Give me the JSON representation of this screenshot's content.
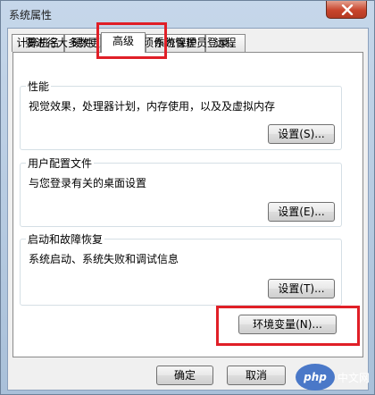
{
  "window": {
    "title": "系统属性"
  },
  "tabs": [
    {
      "label": "计算机名",
      "active": false
    },
    {
      "label": "硬件",
      "active": false
    },
    {
      "label": "高级",
      "active": true
    },
    {
      "label": "系统保护",
      "active": false
    },
    {
      "label": "远程",
      "active": false
    }
  ],
  "panel": {
    "admin_note": "要进行大多数更改，您必须作为管理员登录。",
    "performance": {
      "title": "性能",
      "description": "视觉效果，处理器计划，内存使用，以及及虚拟内存",
      "button": "设置(S)..."
    },
    "user_profiles": {
      "title": "用户配置文件",
      "description": "与您登录有关的桌面设置",
      "button": "设置(E)..."
    },
    "startup_recovery": {
      "title": "启动和故障恢复",
      "description": "系统启动、系统失败和调试信息",
      "button": "设置(T)..."
    },
    "env_button": "环境变量(N)..."
  },
  "footer": {
    "ok": "确定",
    "cancel": "取消"
  },
  "watermark": {
    "logo": "php",
    "text": "中文网"
  },
  "colors": {
    "highlight": "#e01f27",
    "close": "#c8452d"
  }
}
